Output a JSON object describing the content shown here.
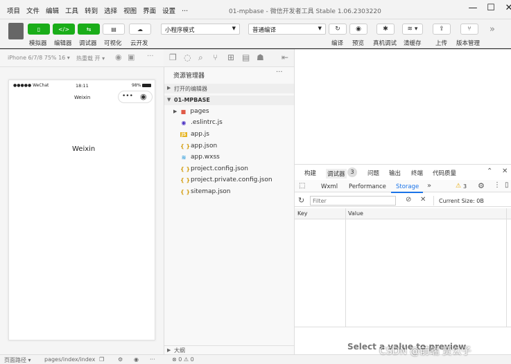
{
  "menubar": {
    "items": [
      "项目",
      "文件",
      "编辑",
      "工具",
      "转到",
      "选择",
      "视图",
      "界面",
      "设置",
      "..."
    ],
    "title": "01-mpbase - 微信开发者工具 Stable 1.06.2303220"
  },
  "toolbar": {
    "simulator_label": "模拟器",
    "editor_label": "编辑器",
    "debugger_label": "调试器",
    "visual_label": "可视化",
    "cloud_label": "云开发",
    "mode_select": "小程序模式",
    "compile_select": "普通编译",
    "compile_label": "编译",
    "preview_label": "预览",
    "remote_debug_label": "真机调试",
    "clear_cache_label": "清缓存",
    "upload_label": "上传",
    "version_label": "版本管理",
    "more": "»"
  },
  "simulator": {
    "device": "iPhone 6/7/8 75% 16 ▾",
    "hot_reload": "热重载 开 ▾",
    "more": "···",
    "status_signal": "●●●●● WeChat",
    "status_time": "18:11",
    "status_battery": "98%",
    "nav_title": "Weixin",
    "page_text": "Weixin"
  },
  "explorer": {
    "title": "资源管理器",
    "more": "···",
    "open_editors": "打开的编辑器",
    "project": "01-MPBASE",
    "files": [
      {
        "name": "pages",
        "icon": "■"
      },
      {
        "name": ".eslintrc.js",
        "icon": "◉"
      },
      {
        "name": "app.js",
        "icon": "JS"
      },
      {
        "name": "app.json",
        "icon": "{ }"
      },
      {
        "name": "app.wxss",
        "icon": "≋"
      },
      {
        "name": "project.config.json",
        "icon": "{ }"
      },
      {
        "name": "project.private.config.json",
        "icon": "{ }"
      },
      {
        "name": "sitemap.json",
        "icon": "{ }"
      }
    ],
    "outline": "大纲"
  },
  "devtools": {
    "top_tabs": [
      "构建",
      "调试器",
      "问题",
      "输出",
      "终端",
      "代码质量"
    ],
    "debugger_badge": "3",
    "sub_tabs": [
      "Wxml",
      "Performance",
      "Storage"
    ],
    "warn_count": "3",
    "filter_placeholder": "Filter",
    "current_size": "Current Size: 0B",
    "col_key": "Key",
    "col_value": "Value",
    "select_hint": "Select a value to preview"
  },
  "statusbar": {
    "page_path_label": "页面路径 ▾",
    "page_path": "pages/index/index",
    "errors": "⊗ 0 ⚠ 0"
  },
  "watermark": "CSDN @前端 贾公子"
}
